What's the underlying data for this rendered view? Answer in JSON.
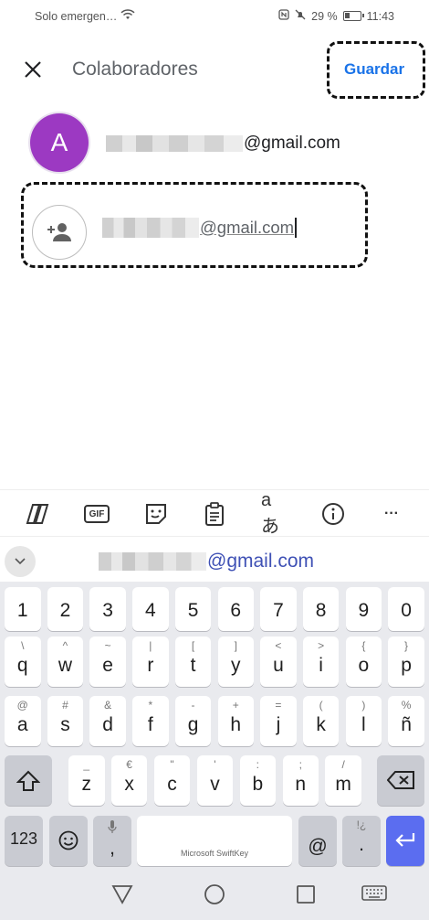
{
  "status_bar": {
    "carrier": "Solo emergen…",
    "battery": "29 %",
    "time": "11:43"
  },
  "app_bar": {
    "close_icon": "close-icon",
    "title": "Colaboradores",
    "save_label": "Guardar"
  },
  "owner": {
    "avatar_letter": "A",
    "avatar_color": "#9c39c2",
    "email_visible": "@gmail.com"
  },
  "new_collaborator": {
    "icon": "person-add-icon",
    "input_value_visible": "@gmail.com"
  },
  "keyboard_toolbar": {
    "items": [
      "copilot-icon",
      "gif-icon",
      "sticker-icon",
      "clipboard-icon",
      "translate-icon",
      "info-icon",
      "more-icon"
    ],
    "gif_label": "GIF",
    "translate_label": "aあ",
    "more_label": "···"
  },
  "suggestion": {
    "text_visible": "@gmail.com"
  },
  "keyboard": {
    "row_numbers": [
      "1",
      "2",
      "3",
      "4",
      "5",
      "6",
      "7",
      "8",
      "9",
      "0"
    ],
    "row1": [
      [
        "q",
        "\\"
      ],
      [
        "w",
        "^"
      ],
      [
        "e",
        "~"
      ],
      [
        "r",
        "|"
      ],
      [
        "t",
        "["
      ],
      [
        "y",
        "]"
      ],
      [
        "u",
        "<"
      ],
      [
        "i",
        ">"
      ],
      [
        "o",
        "{"
      ],
      [
        "p",
        "}"
      ]
    ],
    "row2": [
      [
        "a",
        "@"
      ],
      [
        "s",
        "#"
      ],
      [
        "d",
        "&"
      ],
      [
        "f",
        "*"
      ],
      [
        "g",
        "-"
      ],
      [
        "h",
        "+"
      ],
      [
        "j",
        "="
      ],
      [
        "k",
        "("
      ],
      [
        "l",
        ")"
      ],
      [
        "ñ",
        "%"
      ]
    ],
    "row3": [
      [
        "z",
        "_"
      ],
      [
        "x",
        "€"
      ],
      [
        "c",
        "\""
      ],
      [
        "v",
        "'"
      ],
      [
        "b",
        ":"
      ],
      [
        "n",
        ";"
      ],
      [
        "m",
        "/"
      ]
    ],
    "sym_label": "123",
    "comma": ",",
    "space_label": "Microsoft SwiftKey",
    "at": "@",
    "period": ".",
    "period_alt": "!¿",
    "enter_color": "#5b6df0"
  },
  "nav_bar": {
    "items": [
      "back-icon",
      "home-icon",
      "recents-icon",
      "keyboard-icon"
    ]
  }
}
